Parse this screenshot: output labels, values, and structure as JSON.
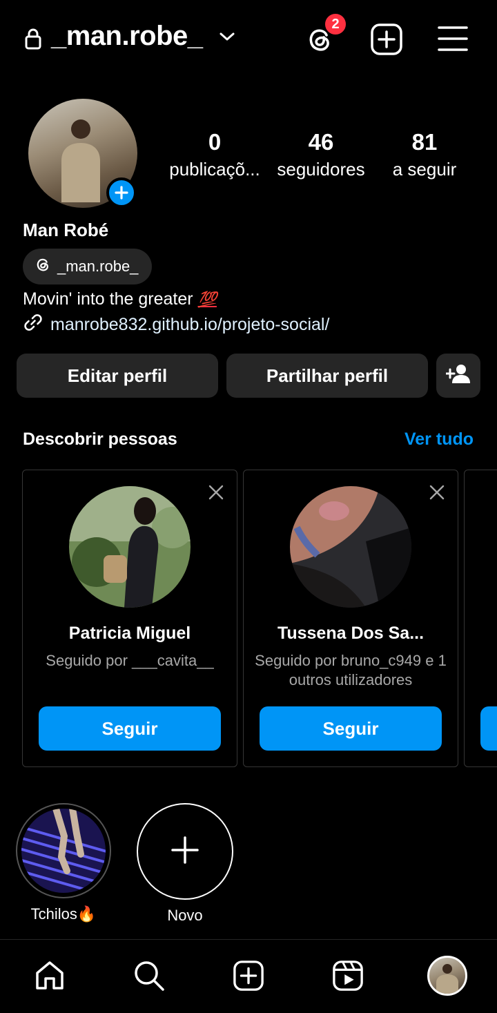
{
  "header": {
    "username": "_man.robe_",
    "threads_badge_count": "2"
  },
  "profile": {
    "full_name": "Man Robé",
    "stats": [
      {
        "value": "0",
        "label": "publicaçõ..."
      },
      {
        "value": "46",
        "label": "seguidores"
      },
      {
        "value": "81",
        "label": "a seguir"
      }
    ],
    "threads_handle": "_man.robe_",
    "bio_text": "Movin' into the greater ",
    "bio_emoji": "💯",
    "link": "manrobe832.github.io/projeto-social/"
  },
  "actions": {
    "edit_profile": "Editar perfil",
    "share_profile": "Partilhar perfil"
  },
  "discover": {
    "title": "Descobrir pessoas",
    "see_all": "Ver tudo",
    "cards": [
      {
        "name": "Patricia Miguel",
        "subtitle": "Seguido por ___cavita__",
        "button": "Seguir"
      },
      {
        "name": "Tussena Dos Sa...",
        "subtitle": "Seguido por bruno_c949 e 1 outros utilizadores",
        "button": "Seguir"
      }
    ]
  },
  "highlights": [
    {
      "label": "Tchilos🔥"
    },
    {
      "label": "Novo"
    }
  ],
  "colors": {
    "accent": "#0095f6",
    "badge": "#ff3040",
    "button_bg": "#262626"
  },
  "icons": [
    "lock-icon",
    "chevron-down-icon",
    "threads-icon",
    "plus-square-icon",
    "hamburger-menu-icon",
    "link-icon",
    "add-person-icon",
    "close-icon",
    "home-icon",
    "search-icon",
    "reels-icon"
  ]
}
